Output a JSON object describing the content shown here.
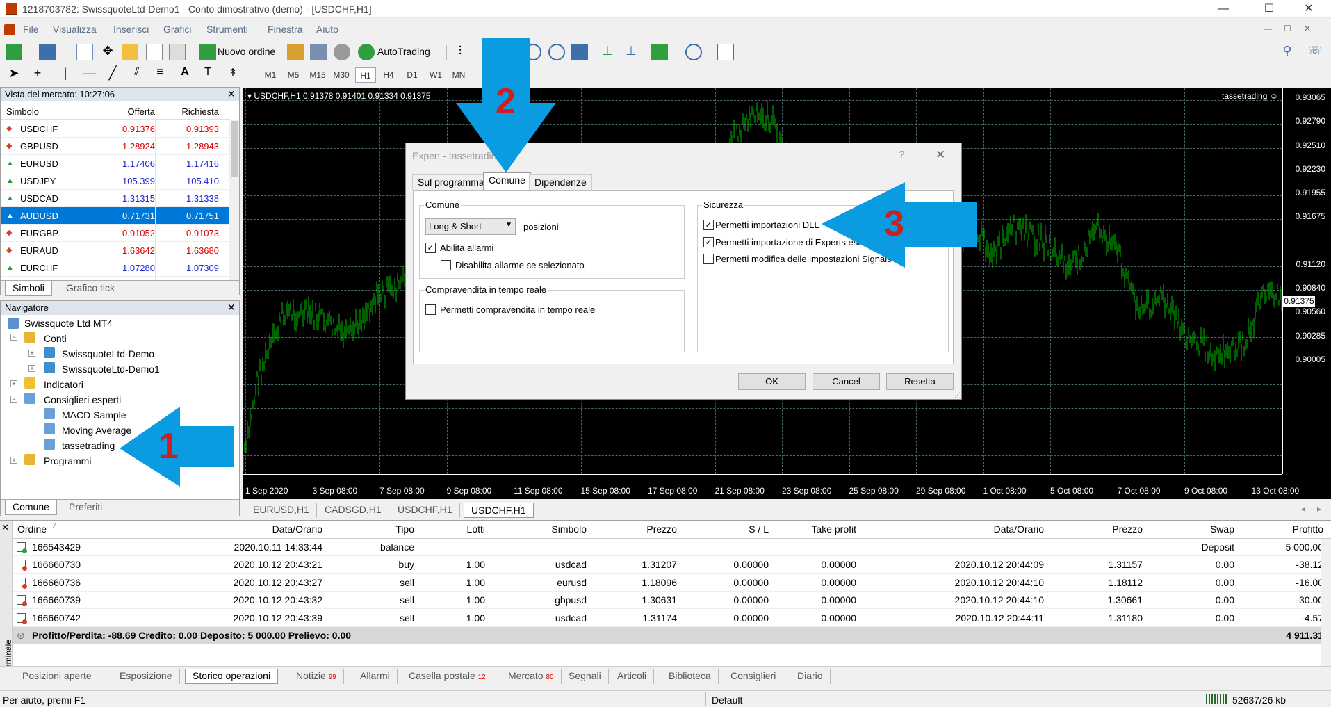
{
  "window": {
    "title": "1218703782: SwissquoteLtd-Demo1 - Conto dimostrativo (demo) - [USDCHF,H1]",
    "min_glyph": "—",
    "max_glyph": "☐",
    "close_glyph": "✕"
  },
  "menu": [
    "File",
    "Visualizza",
    "Inserisci",
    "Grafici",
    "Strumenti",
    "Finestra",
    "Aiuto"
  ],
  "toolbar": {
    "new_order": "Nuovo ordine",
    "autotrading": "AutoTrading",
    "timeframes": [
      "M1",
      "M5",
      "M15",
      "M30",
      "H1",
      "H4",
      "D1",
      "W1",
      "MN"
    ],
    "selected_timeframe": "H1"
  },
  "market_watch": {
    "title": "Vista del mercato: 10:27:06",
    "columns": [
      "Simbolo",
      "Offerta",
      "Richiesta"
    ],
    "rows": [
      {
        "symbol": "USDCHF",
        "bid": "0.91376",
        "ask": "0.91393",
        "dir": "down",
        "color": "red"
      },
      {
        "symbol": "GBPUSD",
        "bid": "1.28924",
        "ask": "1.28943",
        "dir": "down",
        "color": "red"
      },
      {
        "symbol": "EURUSD",
        "bid": "1.17406",
        "ask": "1.17416",
        "dir": "up",
        "color": "blue"
      },
      {
        "symbol": "USDJPY",
        "bid": "105.399",
        "ask": "105.410",
        "dir": "up",
        "color": "blue"
      },
      {
        "symbol": "USDCAD",
        "bid": "1.31315",
        "ask": "1.31338",
        "dir": "up",
        "color": "blue"
      },
      {
        "symbol": "AUDUSD",
        "bid": "0.71731",
        "ask": "0.71751",
        "dir": "up",
        "color": "selected"
      },
      {
        "symbol": "EURGBP",
        "bid": "0.91052",
        "ask": "0.91073",
        "dir": "down",
        "color": "red"
      },
      {
        "symbol": "EURAUD",
        "bid": "1.63642",
        "ask": "1.63680",
        "dir": "down",
        "color": "red"
      },
      {
        "symbol": "EURCHF",
        "bid": "1.07280",
        "ask": "1.07309",
        "dir": "up",
        "color": "blue"
      }
    ],
    "tabs": [
      "Simboli",
      "Grafico tick"
    ]
  },
  "navigator": {
    "title": "Navigatore",
    "root": "Swissquote Ltd MT4",
    "accounts_label": "Conti",
    "accounts": [
      "SwissquoteLtd-Demo",
      "SwissquoteLtd-Demo1"
    ],
    "indicators": "Indicatori",
    "experts_label": "Consiglieri esperti",
    "experts": [
      "MACD Sample",
      "Moving Average",
      "tassetrading"
    ],
    "scripts": "Programmi",
    "tabs": [
      "Comune",
      "Preferiti"
    ]
  },
  "chart": {
    "header": "USDCHF,H1  0.91378 0.91401 0.91334 0.91375",
    "ea_label": "tassetrading ☺",
    "current_price": "0.91375",
    "price_labels": [
      "0.93065",
      "0.92790",
      "0.92510",
      "0.92230",
      "0.91955",
      "0.91675",
      "0.91375",
      "0.91120",
      "0.90840",
      "0.90560",
      "0.90285",
      "0.90005"
    ],
    "date_labels": [
      "1 Sep 2020",
      "3 Sep 08:00",
      "7 Sep 08:00",
      "9 Sep 08:00",
      "11 Sep 08:00",
      "15 Sep 08:00",
      "17 Sep 08:00",
      "21 Sep 08:00",
      "23 Sep 08:00",
      "25 Sep 08:00",
      "29 Sep 08:00",
      "1 Oct 08:00",
      "5 Oct 08:00",
      "7 Oct 08:00",
      "9 Oct 08:00",
      "13 Oct 08:00"
    ],
    "tabs": [
      "EURUSD,H1",
      "CADSGD,H1",
      "USDCHF,H1",
      "USDCHF,H1"
    ],
    "active_tab_index": 3,
    "line_color": "#00c000"
  },
  "dialog": {
    "title": "Expert - tassetrading",
    "help_glyph": "?",
    "close_glyph": "✕",
    "tabs": [
      "Sul programma",
      "Comune",
      "Dipendenze"
    ],
    "active_tab": "Comune",
    "comune_group": "Comune",
    "position_select": "Long & Short",
    "position_suffix": "posizioni",
    "enable_alerts": "Abilita allarmi",
    "enable_alerts_checked": true,
    "disable_alerts_selected": "Disabilita allarme se selezionato",
    "disable_alerts_checked": false,
    "live_group": "Compravendita in tempo reale",
    "allow_live": "Permetti compravendita in tempo reale",
    "allow_live_checked": false,
    "security_group": "Sicurezza",
    "allow_dll": "Permetti importazioni DLL",
    "allow_dll_checked": true,
    "allow_experts": "Permetti importazione di Experts esterni",
    "allow_experts_checked": true,
    "allow_signals": "Permetti modifica delle impostazioni Signals",
    "allow_signals_checked": false,
    "ok": "OK",
    "cancel": "Cancel",
    "reset": "Resetta"
  },
  "annotations": [
    "1",
    "2",
    "3"
  ],
  "terminal": {
    "side_label": "Terminale",
    "columns": [
      "Ordine",
      "Data/Orario",
      "Tipo",
      "Lotti",
      "Simbolo",
      "Prezzo",
      "S / L",
      "Take profit",
      "Data/Orario",
      "Prezzo",
      "Swap",
      "Profitto"
    ],
    "rows": [
      {
        "order": "166543429",
        "open_time": "2020.10.11 14:33:44",
        "type": "balance",
        "lots": "",
        "symbol": "",
        "price": "",
        "sl": "",
        "tp": "",
        "close_time": "",
        "close_price": "",
        "swap": "Deposit",
        "profit": "5 000.00"
      },
      {
        "order": "166660730",
        "open_time": "2020.10.12 20:43:21",
        "type": "buy",
        "lots": "1.00",
        "symbol": "usdcad",
        "price": "1.31207",
        "sl": "0.00000",
        "tp": "0.00000",
        "close_time": "2020.10.12 20:44:09",
        "close_price": "1.31157",
        "swap": "0.00",
        "profit": "-38.12"
      },
      {
        "order": "166660736",
        "open_time": "2020.10.12 20:43:27",
        "type": "sell",
        "lots": "1.00",
        "symbol": "eurusd",
        "price": "1.18096",
        "sl": "0.00000",
        "tp": "0.00000",
        "close_time": "2020.10.12 20:44:10",
        "close_price": "1.18112",
        "swap": "0.00",
        "profit": "-16.00"
      },
      {
        "order": "166660739",
        "open_time": "2020.10.12 20:43:32",
        "type": "sell",
        "lots": "1.00",
        "symbol": "gbpusd",
        "price": "1.30631",
        "sl": "0.00000",
        "tp": "0.00000",
        "close_time": "2020.10.12 20:44:10",
        "close_price": "1.30661",
        "swap": "0.00",
        "profit": "-30.00"
      },
      {
        "order": "166660742",
        "open_time": "2020.10.12 20:43:39",
        "type": "sell",
        "lots": "1.00",
        "symbol": "usdcad",
        "price": "1.31174",
        "sl": "0.00000",
        "tp": "0.00000",
        "close_time": "2020.10.12 20:44:11",
        "close_price": "1.31180",
        "swap": "0.00",
        "profit": "-4.57"
      }
    ],
    "summary": "Profitto/Perdita: -88.69  Credito: 0.00  Deposito: 5 000.00  Prelievo: 0.00",
    "summary_total": "4 911.31",
    "tabs": [
      {
        "label": "Posizioni aperte",
        "badge": ""
      },
      {
        "label": "Esposizione",
        "badge": ""
      },
      {
        "label": "Storico operazioni",
        "badge": ""
      },
      {
        "label": "Notizie",
        "badge": "99"
      },
      {
        "label": "Allarmi",
        "badge": ""
      },
      {
        "label": "Casella postale",
        "badge": "12"
      },
      {
        "label": "Mercato",
        "badge": "80"
      },
      {
        "label": "Segnali",
        "badge": ""
      },
      {
        "label": "Articoli",
        "badge": ""
      },
      {
        "label": "Biblioteca",
        "badge": ""
      },
      {
        "label": "Consiglieri",
        "badge": ""
      },
      {
        "label": "Diario",
        "badge": ""
      }
    ],
    "active_tab": "Storico operazioni"
  },
  "statusbar": {
    "help": "Per aiuto, premi F1",
    "profile": "Default",
    "traffic": "52637/26 kb"
  },
  "colors": {
    "arrow_blue": "#0a9be0",
    "annotation_red": "#d01e1e",
    "selection_blue": "#0078d7"
  }
}
